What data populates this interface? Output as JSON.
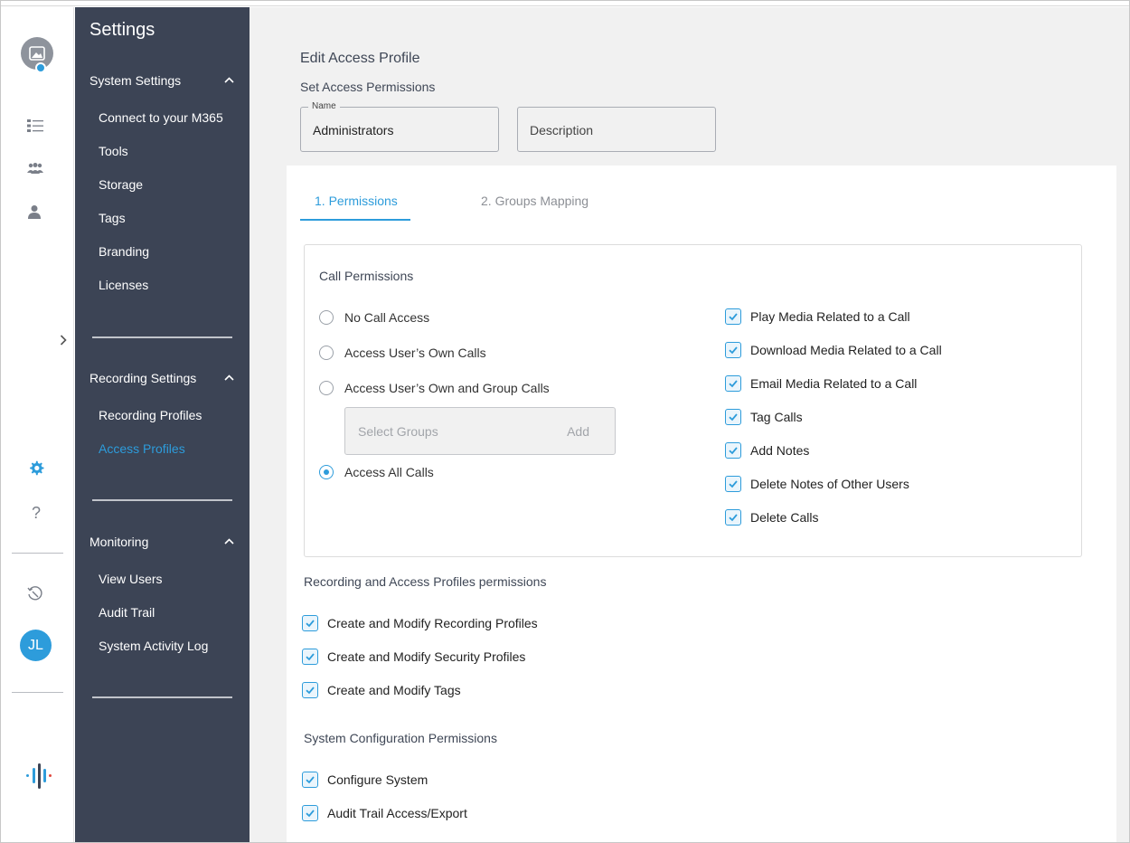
{
  "sidebar": {
    "title": "Settings",
    "sections": [
      {
        "label": "System Settings",
        "items": [
          "Connect to your M365",
          "Tools",
          "Storage",
          "Tags",
          "Branding",
          "Licenses"
        ]
      },
      {
        "label": "Recording Settings",
        "items": [
          "Recording Profiles",
          "Access Profiles"
        ]
      },
      {
        "label": "Monitoring",
        "items": [
          "View Users",
          "Audit Trail",
          "System Activity Log"
        ]
      }
    ],
    "active_item": "Access Profiles"
  },
  "rail": {
    "user_initials": "JL",
    "icons": [
      "image-avatar-icon",
      "list-icon",
      "group-icon",
      "user-icon",
      "expand-chevron-icon",
      "gear-icon",
      "help-icon",
      "history-icon",
      "logo-icon"
    ]
  },
  "main": {
    "title": "Edit Access Profile",
    "subtitle": "Set Access Permissions",
    "name_field": {
      "legend": "Name",
      "value": "Administrators"
    },
    "description_field": {
      "placeholder": "Description"
    },
    "tabs": [
      {
        "label": "1. Permissions",
        "active": true
      },
      {
        "label": "2. Groups Mapping",
        "active": false
      }
    ],
    "call_permissions": {
      "title": "Call Permissions",
      "radios": [
        {
          "label": "No Call Access",
          "selected": false
        },
        {
          "label": "Access User’s Own Calls",
          "selected": false
        },
        {
          "label": "Access User’s Own and Group Calls",
          "selected": false
        },
        {
          "label": "Access All Calls",
          "selected": true
        }
      ],
      "groups_placeholder": "Select Groups",
      "groups_add": "Add",
      "checkboxes": [
        "Play Media Related to a Call",
        "Download Media Related to a Call",
        "Email Media Related to a Call",
        "Tag Calls",
        "Add Notes",
        "Delete Notes of Other Users",
        "Delete Calls"
      ]
    },
    "recording_permissions": {
      "title": "Recording and Access Profiles permissions",
      "checkboxes": [
        "Create and Modify Recording Profiles",
        "Create and Modify Security Profiles",
        "Create and Modify Tags"
      ]
    },
    "system_permissions": {
      "title": "System Configuration Permissions",
      "checkboxes": [
        "Configure System",
        "Audit Trail Access/Export"
      ]
    }
  },
  "colors": {
    "accent": "#2d9cdb",
    "sidebar_bg": "#3c4455",
    "main_bg": "#f1f1f1"
  }
}
